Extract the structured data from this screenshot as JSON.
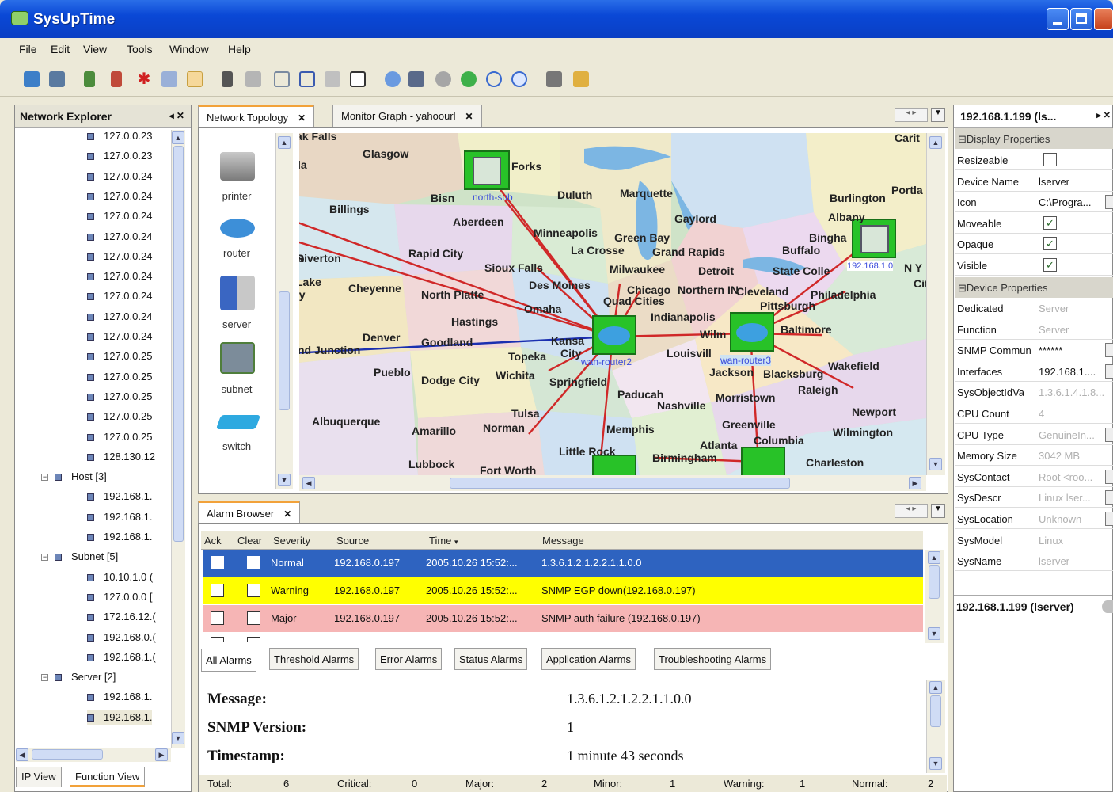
{
  "window": {
    "title": "SysUpTime"
  },
  "menu": [
    "File",
    "Edit",
    "View",
    "Tools",
    "Window",
    "Help"
  ],
  "explorer": {
    "title": "Network Explorer",
    "items": [
      "127.0.0.23",
      "127.0.0.23",
      "127.0.0.24",
      "127.0.0.24",
      "127.0.0.24",
      "127.0.0.24",
      "127.0.0.24",
      "127.0.0.24",
      "127.0.0.24",
      "127.0.0.24",
      "127.0.0.24",
      "127.0.0.25",
      "127.0.0.25",
      "127.0.0.25",
      "127.0.0.25",
      "127.0.0.25",
      "128.130.12"
    ],
    "host_group": "Host [3]",
    "host_items": [
      "192.168.1.",
      "192.168.1.",
      "192.168.1."
    ],
    "subnet_group": "Subnet [5]",
    "subnet_items": [
      "10.10.1.0 (",
      "127.0.0.0 [",
      "172.16.12.(",
      "192.168.0.(",
      "192.168.1.("
    ],
    "server_group": "Server [2]",
    "server_items": [
      "192.168.1.",
      "192.168.1."
    ],
    "bottom_tabs": [
      "IP View",
      "Function View"
    ]
  },
  "topology": {
    "tabs": [
      "Network Topology",
      "Monitor Graph - yahoourl"
    ],
    "palette": [
      "printer",
      "router",
      "server",
      "subnet",
      "switch"
    ],
    "cities": [
      "Glasgow",
      "Forks",
      "Bisn",
      "Duluth",
      "Marquette",
      "Burlington",
      "Portla",
      "Billings",
      "Aberdeen",
      "Gaylord",
      "Albany",
      "Minneapolis",
      "Green Bay",
      "Bingha",
      "La Crosse",
      "Grand Rapids",
      "Buffalo",
      "Riverton",
      "Rapid City",
      "Sioux Falls",
      "Milwaukee",
      "Detroit",
      "State Colle",
      "Lake",
      "Cheyenne",
      "North Platte",
      "Des Moines",
      "Chicago",
      "Northern IN",
      "Cleveland",
      "Philadelphia",
      "Quad Cities",
      "Omaha",
      "Pittsburgh",
      "Hastings",
      "Indianapolis",
      "Baltimore",
      "Denver",
      "Goodland",
      "Kansa",
      "Wilm",
      "Topeka",
      "City",
      "Louisvill",
      "nd Junction",
      "Pueblo",
      "Dodge City",
      "Wichita",
      "Springfield",
      "Jackson",
      "Blacksburg",
      "Wakefield",
      "Raleigh",
      "Paducah",
      "Nashville",
      "Morristown",
      "Newport",
      "Albuquerque",
      "Amarillo",
      "Tulsa",
      "Norman",
      "Memphis",
      "Greenville",
      "Wilmington",
      "Atlanta",
      "Columbia",
      "Little Rock",
      "Birmingham",
      "Charleston",
      "Lubbock",
      "Fort Worth",
      "Carit",
      "ak Falls",
      "la",
      "o",
      "cy",
      "N Y",
      "City"
    ],
    "nodes": {
      "north_sub": "north-sub",
      "wan_router2": "wan-router2",
      "wan_router3": "wan-router3",
      "ip_label": "192.168.1.0"
    }
  },
  "alarm": {
    "tab": "Alarm Browser",
    "columns": [
      "Ack",
      "Clear",
      "Severity",
      "Source",
      "Time",
      "Message"
    ],
    "rows": [
      {
        "severity": "Normal",
        "source": "192.168.0.197",
        "time": "2005.10.26 15:52:...",
        "message": "1.3.6.1.2.1.2.2.1.1.0.0"
      },
      {
        "severity": "Warning",
        "source": "192.168.0.197",
        "time": "2005.10.26 15:52:...",
        "message": "SNMP EGP down(192.168.0.197)"
      },
      {
        "severity": "Major",
        "source": "192.168.0.197",
        "time": "2005.10.26 15:52:...",
        "message": "SNMP auth failure (192.168.0.197)"
      }
    ],
    "row_colors": [
      "#2e63c0",
      "#ffff00",
      "#f6b5b5"
    ],
    "subtabs": [
      "All Alarms",
      "Threshold Alarms",
      "Error Alarms",
      "Status Alarms",
      "Application Alarms",
      "Troubleshooting Alarms"
    ],
    "detail": {
      "message_label": "Message:",
      "message_value": "1.3.6.1.2.1.2.2.1.1.0.0",
      "snmp_label": "SNMP Version:",
      "snmp_value": "1",
      "ts_label": "Timestamp:",
      "ts_value": "1 minute 43 seconds"
    },
    "summary": {
      "total_label": "Total:",
      "total": "6",
      "critical_label": "Critical:",
      "critical": "0",
      "major_label": "Major:",
      "major": "2",
      "minor_label": "Minor:",
      "minor": "1",
      "warning_label": "Warning:",
      "warning": "1",
      "normal_label": "Normal:",
      "normal": "2"
    }
  },
  "properties": {
    "title": "192.168.1.199 (ls...",
    "display_section": "Display Properties",
    "device_section": "Device Properties",
    "display": [
      {
        "k": "Resizeable",
        "type": "check",
        "checked": false
      },
      {
        "k": "Device Name",
        "v": "lserver"
      },
      {
        "k": "Icon",
        "v": "C:\\Progra..."
      },
      {
        "k": "Moveable",
        "type": "check",
        "checked": true
      },
      {
        "k": "Opaque",
        "type": "check",
        "checked": true
      },
      {
        "k": "Visible",
        "type": "check",
        "checked": true
      }
    ],
    "device": [
      {
        "k": "Dedicated",
        "v": "Server",
        "dim": true
      },
      {
        "k": "Function",
        "v": "Server",
        "dim": true
      },
      {
        "k": "SNMP Commun",
        "v": "******"
      },
      {
        "k": "Interfaces",
        "v": "192.168.1...."
      },
      {
        "k": "SysObjectIdVa",
        "v": "1.3.6.1.4.1.8...",
        "dim": true
      },
      {
        "k": "CPU Count",
        "v": "4",
        "dim": true
      },
      {
        "k": "CPU Type",
        "v": "GenuineIn...",
        "dim": true
      },
      {
        "k": "Memory Size",
        "v": "3042 MB",
        "dim": true
      },
      {
        "k": "SysContact",
        "v": "Root <roo...",
        "dim": true
      },
      {
        "k": "SysDescr",
        "v": "Linux lser...",
        "dim": true
      },
      {
        "k": "SysLocation",
        "v": "Unknown",
        "dim": true
      },
      {
        "k": "SysModel",
        "v": "Linux",
        "dim": true
      },
      {
        "k": "SysName",
        "v": "lserver",
        "dim": true
      }
    ],
    "footer": "192.168.1.199 (lserver)"
  }
}
